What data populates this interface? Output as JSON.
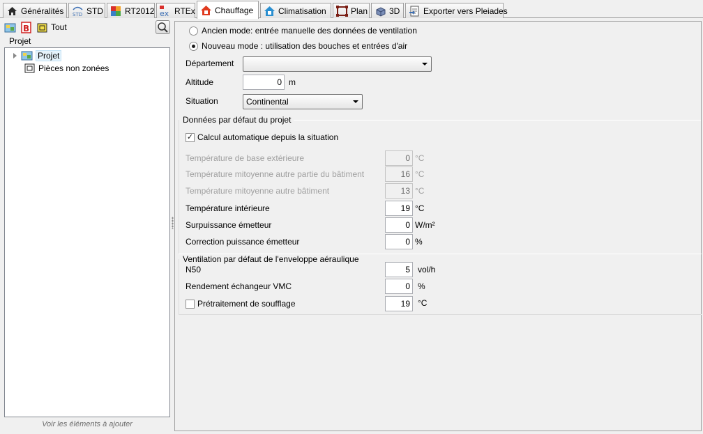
{
  "tabs": [
    {
      "label": "Généralités",
      "icon": "house-icon"
    },
    {
      "label": "STD",
      "icon": "std-icon"
    },
    {
      "label": "RT2012",
      "icon": "rt2012-icon"
    },
    {
      "label": "RTEx",
      "icon": "rtex-icon"
    },
    {
      "label": "Chauffage",
      "icon": "heating-house-icon",
      "active": true
    },
    {
      "label": "Climatisation",
      "icon": "aircon-house-icon"
    },
    {
      "label": "Plan",
      "icon": "plan-icon"
    },
    {
      "label": "3D",
      "icon": "3d-icon"
    },
    {
      "label": "Exporter vers Pleiades",
      "icon": "export-icon"
    }
  ],
  "left": {
    "toolbar": {
      "all_label": "Tout"
    },
    "tree_title": "Projet",
    "tree": [
      {
        "label": "Projet"
      },
      {
        "label": "Pièces non zonées"
      }
    ],
    "footer": "Voir les éléments à ajouter"
  },
  "mode": {
    "old_label": "Ancien mode: entrée manuelle des données de ventilation",
    "new_label": "Nouveau mode : utilisation des bouches et entrées d'air",
    "selected": "new"
  },
  "general": {
    "departement_label": "Département",
    "departement_value": "",
    "altitude_label": "Altitude",
    "altitude_value": "0",
    "altitude_unit": "m",
    "situation_label": "Situation",
    "situation_value": "Continental"
  },
  "defaults": {
    "title": "Données par défaut du projet",
    "auto_calc_label": "Calcul automatique depuis la situation",
    "auto_calc_checked": true,
    "check_mark": "✓",
    "fields": [
      {
        "label": "Température de base extérieure",
        "value": "0",
        "unit": "°C",
        "disabled": true
      },
      {
        "label": "Température mitoyenne autre partie du bâtiment",
        "value": "16",
        "unit": "°C",
        "disabled": true
      },
      {
        "label": "Température mitoyenne autre bâtiment",
        "value": "13",
        "unit": "°C",
        "disabled": true
      },
      {
        "label": "Température intérieure",
        "value": "19",
        "unit": "°C",
        "disabled": false
      },
      {
        "label": "Surpuissance émetteur",
        "value": "0",
        "unit": "W/m²",
        "disabled": false
      },
      {
        "label": "Correction puissance émetteur",
        "value": "0",
        "unit": "%",
        "disabled": false
      }
    ]
  },
  "ventilation": {
    "title": "Ventilation par défaut de l'enveloppe aéraulique",
    "n50_label": "N50",
    "n50_value": "5",
    "n50_unit": "vol/h",
    "vmc_label": "Rendement échangeur VMC",
    "vmc_value": "0",
    "vmc_unit": "%",
    "pretreat_label": "Prétraitement de soufflage",
    "pretreat_checked": false,
    "pretreat_value": "19",
    "pretreat_unit": "°C"
  },
  "colors": {
    "active_tab_icon": "#e03a1e",
    "house_icon": "#2a2a2a",
    "aircon_icon": "#2a8fd0"
  }
}
